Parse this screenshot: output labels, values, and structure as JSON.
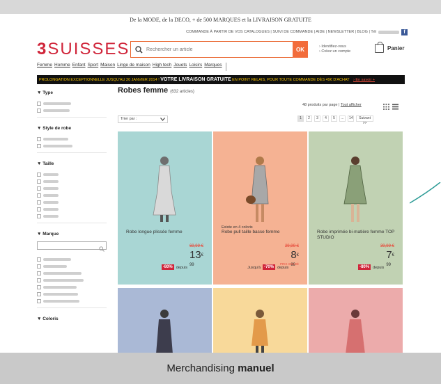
{
  "promo_top": "De la MODE, de la DECO, + de 500 MARQUES et la LIVRAISON GRATUITE",
  "util_bar": {
    "links": "COMMANDE À PARTIR DE VOS CATALOGUES | SUIVI DE COMMANDE | AIDE | NEWSLETTER | BLOG | Tél"
  },
  "logo": {
    "num": "3",
    "name": "SUISSES",
    "color": "#d0253a"
  },
  "search": {
    "placeholder": "Rechercher un article",
    "button": "OK"
  },
  "account": {
    "line1": "› Identifiez-vous",
    "line2": "› Créez un compte"
  },
  "cart_label": "Panier",
  "nav": [
    "Femme",
    "Homme",
    "Enfant",
    "Sport",
    "Maison",
    "Linge de maison",
    "High tech",
    "Jouets",
    "Loisirs",
    "Marques"
  ],
  "banner": {
    "text1": "PROLONGATION EXCEPTIONNELLE JUSQU'AU 20 JANVIER 2014 !",
    "strong": "VOTRE LIVRAISON GRATUITE",
    "text2": "EN POINT RELAIS, POUR TOUTE COMMANDE DÈS 49€ D'ACHAT",
    "link": "› En savoir +"
  },
  "sidebar": {
    "type_title": "▼ Type",
    "style_title": "▼ Style de robe",
    "size_title": "▼ Taille",
    "brand_title": "▼ Marque",
    "color_title": "▼ Coloris"
  },
  "main": {
    "title": "Robes femme",
    "count": "(632 articles)",
    "perpage": "48 produits par page |",
    "showall": "Tout afficher",
    "sort_label": "Trier par :",
    "pages": [
      "1",
      "2",
      "3",
      "4",
      "5",
      "...",
      "14"
    ],
    "next": "Suivant >>"
  },
  "products": [
    {
      "bg": "#a9d6d4",
      "tag": "",
      "name": "Robe longue plissée femme",
      "old_price": "69,99 €",
      "discount": "-80%",
      "depuis": "depuis",
      "price_int": "13",
      "price_dec": "99",
      "currency": "€",
      "sold": ""
    },
    {
      "bg": "#f5b293",
      "tag": "Existe en 4 coloris",
      "name": "Robe pull taille basse femme",
      "old_price": "29,99 €",
      "discount": "-70%",
      "depuis": "Jusqu'à",
      "price_int": "8",
      "price_dec": "99",
      "currency": "€",
      "sold": "PRIX SOLDÉ"
    },
    {
      "bg": "#c1d2b3",
      "tag": "",
      "name": "Robe imprimée bi-matière femme TOP STUDIO",
      "old_price": "39,99 €",
      "discount": "-80%",
      "depuis": "depuis",
      "price_int": "7",
      "price_dec": "99",
      "currency": "€",
      "sold": ""
    },
    {
      "bg": "#aab9d6"
    },
    {
      "bg": "#f8d99a"
    },
    {
      "bg": "#ecabab"
    }
  ],
  "footer": {
    "text": "Merchandising",
    "bold": "manuel"
  }
}
